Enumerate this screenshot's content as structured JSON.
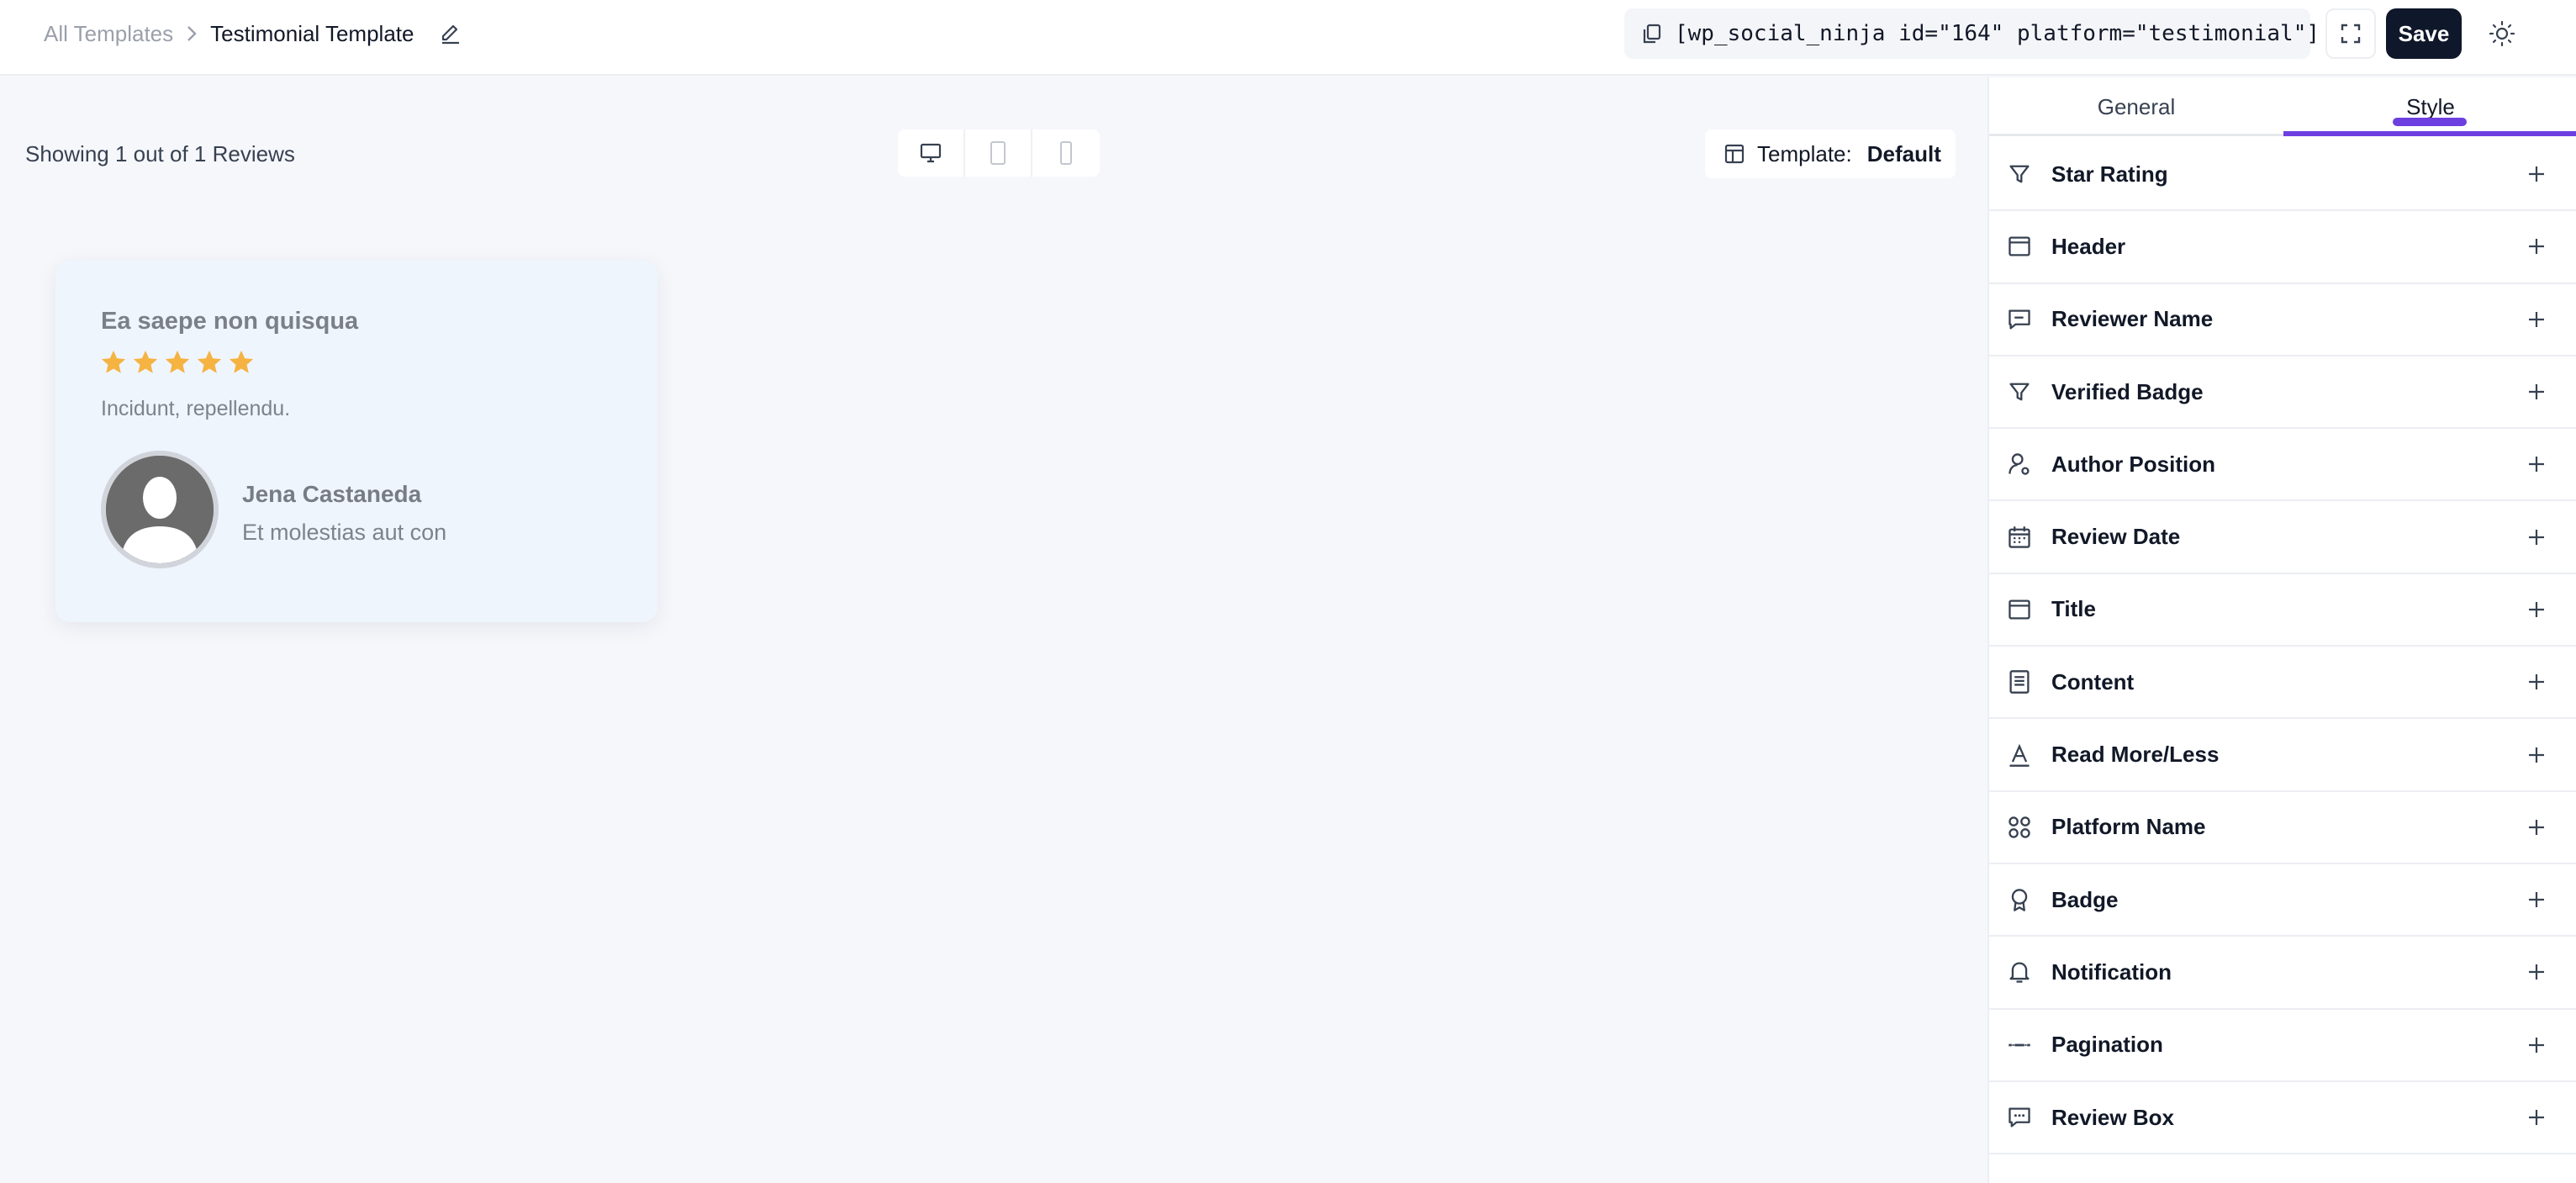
{
  "breadcrumb": {
    "root": "All Templates",
    "current": "Testimonial Template"
  },
  "toolbar": {
    "shortcode": "[wp_social_ninja id=\"164\" platform=\"testimonial\"]",
    "save_label": "Save"
  },
  "canvas": {
    "showing_text": "Showing 1 out of 1 Reviews",
    "template_label": "Template:",
    "template_value": "Default"
  },
  "review": {
    "title": "Ea saepe non quisqua",
    "rating": 5,
    "content": "Incidunt, repellendu.",
    "author_name": "Jena Castaneda",
    "author_position": "Et molestias aut con"
  },
  "panel": {
    "tabs": [
      {
        "label": "General",
        "active": false
      },
      {
        "label": "Style",
        "active": true
      }
    ],
    "sections": [
      {
        "label": "Star Rating",
        "icon": "filter-icon"
      },
      {
        "label": "Header",
        "icon": "layout-icon"
      },
      {
        "label": "Reviewer Name",
        "icon": "message-square-icon"
      },
      {
        "label": "Verified Badge",
        "icon": "filter-icon"
      },
      {
        "label": "Author Position",
        "icon": "user-icon"
      },
      {
        "label": "Review Date",
        "icon": "calendar-icon"
      },
      {
        "label": "Title",
        "icon": "layout-icon"
      },
      {
        "label": "Content",
        "icon": "document-icon"
      },
      {
        "label": "Read More/Less",
        "icon": "text-icon"
      },
      {
        "label": "Platform Name",
        "icon": "apps-icon"
      },
      {
        "label": "Badge",
        "icon": "award-icon"
      },
      {
        "label": "Notification",
        "icon": "bell-icon"
      },
      {
        "label": "Pagination",
        "icon": "pagination-icon"
      },
      {
        "label": "Review Box",
        "icon": "chat-box-icon"
      }
    ]
  },
  "colors": {
    "accent": "#6d3fe0",
    "star": "#f5b342",
    "save_bg": "#0f172a"
  }
}
